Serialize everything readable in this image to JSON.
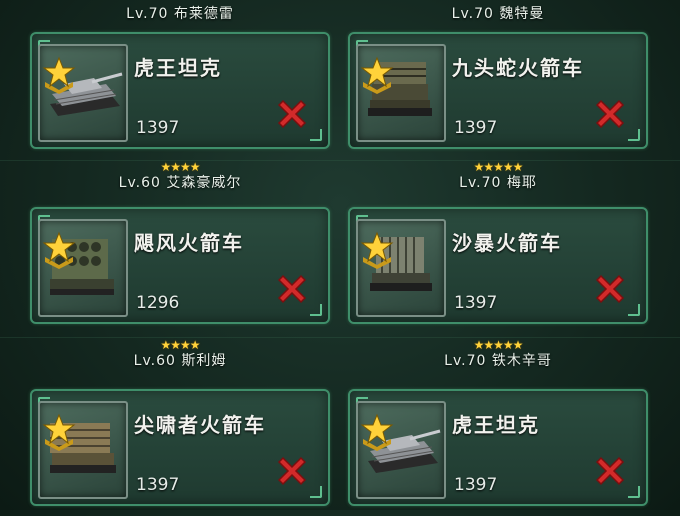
{
  "colors": {
    "accent_border": "#3f8e6a",
    "star": "#ffd23a",
    "remove_x": "#d22a2a",
    "background": "#1a3128"
  },
  "rows": [
    {
      "left": {
        "stars": "",
        "commander": "Lv.70 布莱德雷",
        "tank": {
          "name": "虎王坦克",
          "power": "1397",
          "icon": "tiger-king-tank-icon"
        }
      },
      "right": {
        "stars": "",
        "commander": "Lv.70 魏特曼",
        "tank": {
          "name": "九头蛇火箭车",
          "power": "1397",
          "icon": "hydra-rocket-truck-icon"
        }
      }
    },
    {
      "left": {
        "stars": "★★★★",
        "commander": "Lv.60 艾森豪威尔",
        "tank": {
          "name": "飓风火箭车",
          "power": "1296",
          "icon": "hurricane-rocket-truck-icon"
        }
      },
      "right": {
        "stars": "★★★★★",
        "commander": "Lv.70 梅耶",
        "tank": {
          "name": "沙暴火箭车",
          "power": "1397",
          "icon": "sandstorm-rocket-truck-icon"
        }
      }
    },
    {
      "left": {
        "stars": "★★★★",
        "commander": "Lv.60 斯利姆",
        "tank": {
          "name": "尖啸者火箭车",
          "power": "1397",
          "icon": "screamer-rocket-truck-icon"
        }
      },
      "right": {
        "stars": "★★★★★",
        "commander": "Lv.70 铁木辛哥",
        "tank": {
          "name": "虎王坦克",
          "power": "1397",
          "icon": "tiger-king-tank-icon"
        }
      }
    }
  ]
}
